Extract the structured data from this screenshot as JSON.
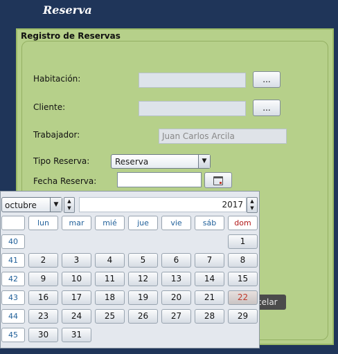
{
  "window": {
    "title": "Reserva"
  },
  "form": {
    "section_title": "Registro de Reservas",
    "habitacion_label": "Habitación:",
    "cliente_label": "Cliente:",
    "trabajador_label": "Trabajador:",
    "trabajador_value": "Juan Carlos Arcila",
    "tipo_label": "Tipo Reserva:",
    "tipo_value": "Reserva",
    "fecha_label": "Fecha Reserva:",
    "browse_label": "...",
    "cancel_label": "celar"
  },
  "calendar": {
    "month": "octubre",
    "year": "2017",
    "weekday_headers": [
      "lun",
      "mar",
      "mié",
      "jue",
      "vie",
      "sáb",
      "dom"
    ],
    "week_numbers": [
      "40",
      "41",
      "42",
      "43",
      "44",
      "45"
    ],
    "weeks": [
      [
        "",
        "",
        "",
        "",
        "",
        "",
        "1"
      ],
      [
        "2",
        "3",
        "4",
        "5",
        "6",
        "7",
        "8"
      ],
      [
        "9",
        "10",
        "11",
        "12",
        "13",
        "14",
        "15"
      ],
      [
        "16",
        "17",
        "18",
        "19",
        "20",
        "21",
        "22"
      ],
      [
        "23",
        "24",
        "25",
        "26",
        "27",
        "28",
        "29"
      ],
      [
        "30",
        "31",
        "",
        "",
        "",
        "",
        ""
      ]
    ],
    "today": "22",
    "today_color": "#c0392b"
  }
}
